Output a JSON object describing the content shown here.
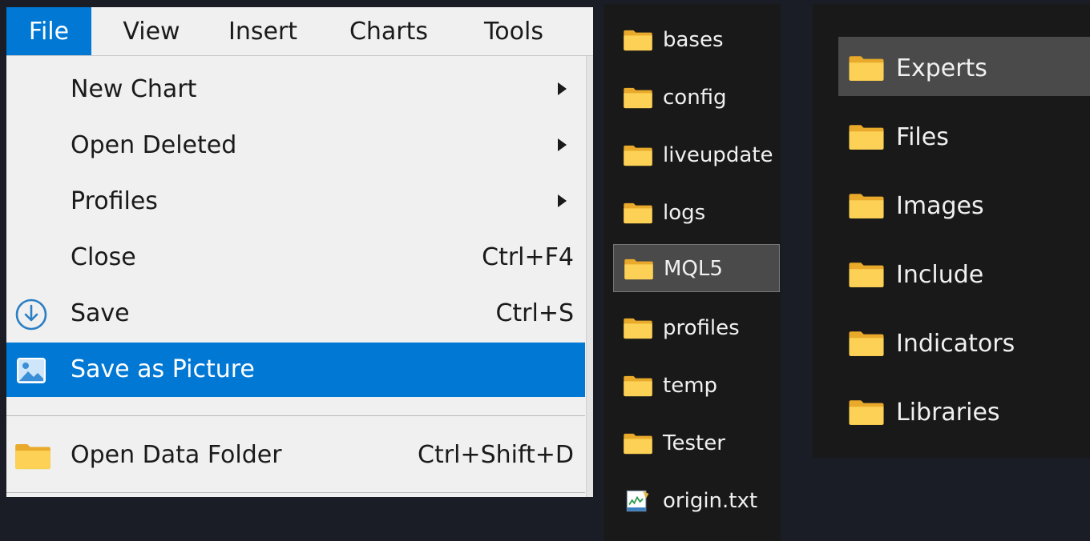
{
  "menubar": {
    "items": [
      {
        "label": "File",
        "active": true
      },
      {
        "label": "View"
      },
      {
        "label": "Insert"
      },
      {
        "label": "Charts"
      },
      {
        "label": "Tools"
      }
    ]
  },
  "file_menu": {
    "items": [
      {
        "label": "New Chart",
        "submenu": true
      },
      {
        "label": "Open Deleted",
        "submenu": true
      },
      {
        "label": "Profiles",
        "submenu": true
      },
      {
        "label": "Close",
        "shortcut": "Ctrl+F4"
      },
      {
        "label": "Save",
        "shortcut": "Ctrl+S",
        "icon": "save-download-icon"
      },
      {
        "label": "Save as Picture",
        "icon": "picture-icon",
        "highlighted": true
      },
      {
        "label": "Open Data Folder",
        "shortcut": "Ctrl+Shift+D",
        "icon": "folder-icon"
      }
    ]
  },
  "data_folder": {
    "items": [
      {
        "name": "bases",
        "type": "folder"
      },
      {
        "name": "config",
        "type": "folder"
      },
      {
        "name": "liveupdate",
        "type": "folder"
      },
      {
        "name": "logs",
        "type": "folder"
      },
      {
        "name": "MQL5",
        "type": "folder",
        "selected": true
      },
      {
        "name": "profiles",
        "type": "folder"
      },
      {
        "name": "temp",
        "type": "folder"
      },
      {
        "name": "Tester",
        "type": "folder"
      },
      {
        "name": "origin.txt",
        "type": "text-file"
      }
    ]
  },
  "mql5_folder": {
    "items": [
      {
        "name": "Experts",
        "selected": true
      },
      {
        "name": "Files"
      },
      {
        "name": "Images"
      },
      {
        "name": "Include"
      },
      {
        "name": "Indicators"
      },
      {
        "name": "Libraries"
      }
    ]
  },
  "colors": {
    "accent": "#0078d4",
    "folder_yellow": "#f8c33a",
    "dark_panel": "#191919",
    "background": "#1a1d26"
  }
}
